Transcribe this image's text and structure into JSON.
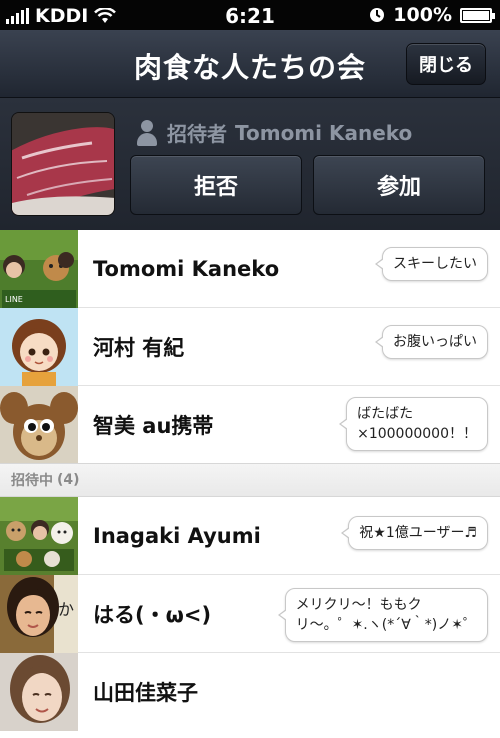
{
  "status_bar": {
    "carrier": "KDDI",
    "time": "6:21",
    "battery": "100%"
  },
  "nav": {
    "title": "肉食な人たちの会",
    "close_label": "閉じる"
  },
  "invite": {
    "inviter_label": "招待者",
    "inviter_name": "Tomomi Kaneko",
    "decline_label": "拒否",
    "join_label": "参加"
  },
  "members": [
    {
      "name": "Tomomi Kaneko",
      "status": "スキーしたい"
    },
    {
      "name": "河村 有紀",
      "status": "お腹いっぱい"
    },
    {
      "name": "智美 au携帯",
      "status_line1": "ばたばた",
      "status_line2": "×100000000！！"
    }
  ],
  "invited_section": {
    "label": "招待中",
    "count": "(4)"
  },
  "invited": [
    {
      "name": "Inagaki Ayumi",
      "status": "祝★1億ユーザー♬"
    },
    {
      "name": "はる(・ω<)",
      "status_line1": "メリクリ〜！ももク",
      "status_line2": "リ〜。゜✶.ヽ(*´∀｀*)ノ✶゜"
    },
    {
      "name": "山田佳菜子"
    }
  ],
  "icons": [
    "signal-icon",
    "wifi-icon",
    "clock-icon",
    "battery-icon",
    "person-icon"
  ]
}
